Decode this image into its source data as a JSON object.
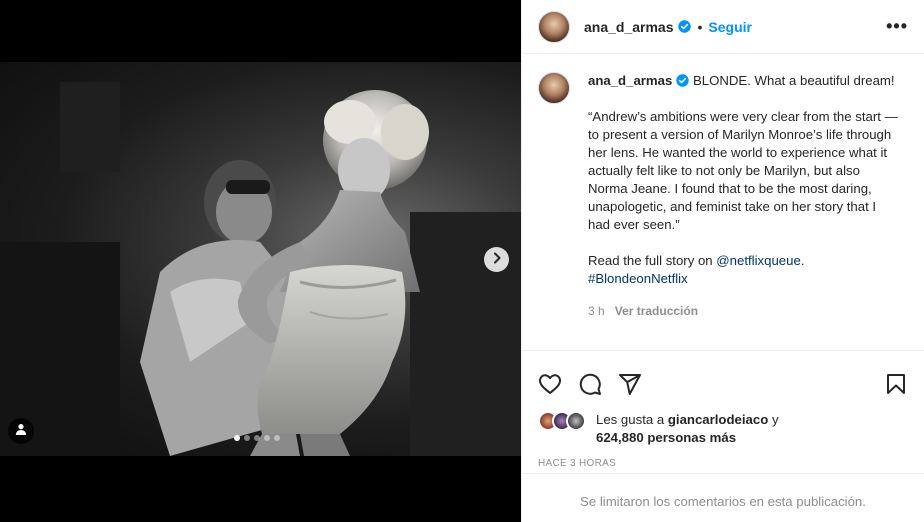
{
  "post": {
    "username": "ana_d_armas",
    "follow_label": "Seguir",
    "separator": "•",
    "more_label": "•••",
    "caption_lead": "BLONDE. What a beautiful dream!",
    "quote": "“Andrew’s ambitions were very clear from the start — to present a version of Marilyn Monroe’s life through her lens. He wanted the world to experience what it actually felt like to not only be Marilyn, but also Norma Jeane. I found that to be the most daring, unapologetic, and feminist take on her story that I had ever seen.”",
    "read_prefix": "Read the full story on ",
    "mention": "@netflixqueue",
    "read_suffix": ".",
    "hashtag": "#BlondeonNetflix",
    "age": "3 h",
    "translate_label": "Ver traducción",
    "likes_prefix": "Les gusta a ",
    "likes_user": "giancarlodeiaco",
    "likes_and": " y",
    "likes_others": "624,880 personas más",
    "timestamp": "HACE 3 HORAS",
    "comments_disabled": "Se limitaron los comentarios en esta publicación."
  },
  "carousel": {
    "total_slides": 5,
    "active_slide": 1
  },
  "icons": {
    "verified": "verified-badge-icon",
    "like": "heart-icon",
    "comment": "comment-icon",
    "share": "paper-plane-icon",
    "save": "bookmark-icon",
    "next": "chevron-right-icon",
    "tags": "user-tag-icon"
  },
  "colors": {
    "accent": "#0095f6",
    "link": "#00376b",
    "muted": "#8e8e8e",
    "text": "#262626"
  }
}
